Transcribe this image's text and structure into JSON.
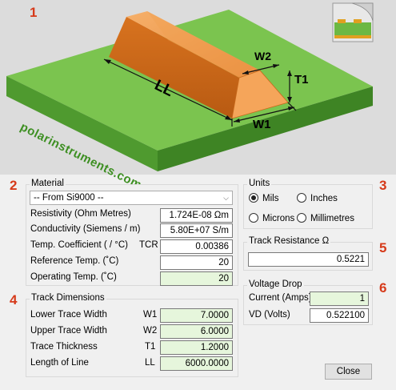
{
  "diagram": {
    "watermark": "polarinstruments.com",
    "labels": {
      "ll": "LL",
      "w1": "W1",
      "w2": "W2",
      "t1": "T1"
    }
  },
  "section_numbers": [
    "1",
    "2",
    "3",
    "4",
    "5",
    "6"
  ],
  "material": {
    "title": "Material",
    "selected": "-- From Si9000 --",
    "rows": [
      {
        "label": "Resistivity (Ohm Metres)",
        "symbol": "",
        "value": "1.724E-08 Ωm"
      },
      {
        "label": "Conductivity (Siemens / m)",
        "symbol": "",
        "value": "5.80E+07 S/m"
      },
      {
        "label": "Temp. Coefficient ( / °C)",
        "symbol": "TCR",
        "value": "0.00386"
      },
      {
        "label": "Reference Temp. (˚C)",
        "symbol": "",
        "value": "20"
      },
      {
        "label": "Operating Temp. (˚C)",
        "symbol": "",
        "value": "20"
      }
    ]
  },
  "units": {
    "title": "Units",
    "options": [
      {
        "label": "Mils",
        "selected": true
      },
      {
        "label": "Inches",
        "selected": false
      },
      {
        "label": "Microns",
        "selected": false
      },
      {
        "label": "Millimetres",
        "selected": false
      }
    ]
  },
  "track_resistance": {
    "title": "Track Resistance Ω",
    "value": "0.5221"
  },
  "track_dimensions": {
    "title": "Track Dimensions",
    "rows": [
      {
        "label": "Lower Trace Width",
        "symbol": "W1",
        "value": "7.0000"
      },
      {
        "label": "Upper Trace Width",
        "symbol": "W2",
        "value": "6.0000"
      },
      {
        "label": "Trace Thickness",
        "symbol": "T1",
        "value": "1.2000"
      },
      {
        "label": "Length of Line",
        "symbol": "LL",
        "value": "6000.0000"
      }
    ]
  },
  "voltage_drop": {
    "title": "Voltage Drop",
    "rows": [
      {
        "label": "Current (Amps)",
        "value": "1"
      },
      {
        "label": "VD (Volts)",
        "value": "0.522100"
      }
    ]
  },
  "buttons": {
    "close": "Close"
  }
}
